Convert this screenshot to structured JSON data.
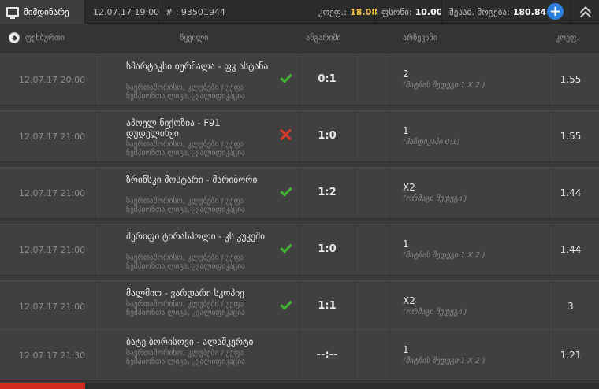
{
  "topbar": {
    "tab_label": "მიმდინარე",
    "datetime": "12.07.17 19:00",
    "ticket_id": "# : 93501944",
    "coef_label": "კოეფ.:",
    "coef_value": "18.08",
    "stake_label": "ფსონი:",
    "stake_value": "10.00",
    "win_label": "შესაძ. მოგება:",
    "win_value": "180.84"
  },
  "header": {
    "sport": "ფეხბურთი",
    "col_event": "წყვილი",
    "col_score": "ანგარიში",
    "col_pick": "არჩევანი",
    "col_odd": "კოეფ."
  },
  "rows": [
    {
      "date": "12.07.17 20:00",
      "teams": "სპარტაკსი იურმალა - ფკ ასტანა",
      "league": "საერთაშორისო, კლუბები / უეფა ჩემპიონთა ლიგა, კვალიფიკაცია",
      "status": "won",
      "score": "0:1",
      "pick": "2",
      "pick_desc": "(მატჩის შედეგი 1 X 2 )",
      "odd": "1.55"
    },
    {
      "date": "12.07.17 21:00",
      "teams": "აპოელ ნიქოზია - F91 დუდელინჟი",
      "league": "საერთაშორისო, კლუბები / უეფა ჩემპიონთა ლიგა, კვალიფიკაცია",
      "status": "lost",
      "score": "1:0",
      "pick": "1",
      "pick_desc": "(ჰანდიკაპი 0:1)",
      "odd": "1.55"
    },
    {
      "date": "12.07.17 21:00",
      "teams": "ზრინსკი მოსტარი - მარიბორი",
      "league": "საერთაშორისო, კლუბები / უეფა ჩემპიონთა ლიგა, კვალიფიკაცია",
      "status": "won",
      "score": "1:2",
      "pick": "X2",
      "pick_desc": "(ორმაგი შედეგი )",
      "odd": "1.44"
    },
    {
      "date": "12.07.17 21:00",
      "teams": "შერიფი ტირასპოლი - კს კუკეში",
      "league": "საერთაშორისო, კლუბები / უეფა ჩემპიონთა ლიგა, კვალიფიკაცია",
      "status": "won",
      "score": "1:0",
      "pick": "1",
      "pick_desc": "(მატჩის შედეგი 1 X 2 )",
      "odd": "1.44"
    },
    {
      "date": "12.07.17 21:00",
      "teams": "მალმიო - ვარდარი სკოპიე",
      "league": "საერთაშორისო, კლუბები / უეფა ჩემპიონთა ლიგა, კვალიფიკაცია",
      "status": "won",
      "score": "1:1",
      "pick": "X2",
      "pick_desc": "(ორმაგი შედეგი )",
      "odd": "3"
    },
    {
      "date": "12.07.17 21:30",
      "teams": "ბატე ბორისოვი - ალაშკერტი",
      "league": "საერთაშორისო, კლუბები / უეფა ჩემპიონთა ლიგა, კვალიფიკაცია",
      "status": "pending",
      "score": "--:--",
      "pick": "1",
      "pick_desc": "(მატჩის შედეგი 1 X 2 )",
      "odd": "1.21"
    }
  ],
  "icons": {
    "tab": "monitor-icon",
    "add": "plus-icon",
    "collapse": "double-chevron-up-icon",
    "sport": "soccer-ball-icon",
    "won": "check-icon",
    "lost": "cross-icon"
  },
  "colors": {
    "accent": "#2a7fe0",
    "coef": "#f0c040",
    "won": "#44b038",
    "lost": "#d83a2a",
    "bottom_tab": "#d32a20"
  }
}
